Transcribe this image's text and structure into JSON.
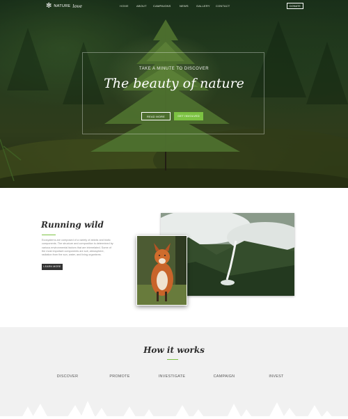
{
  "nav": {
    "logo_text": "NATURE",
    "logo_script": "love",
    "items": [
      {
        "label": "HOME",
        "active": true
      },
      {
        "label": "ABOUT",
        "active": false
      },
      {
        "label": "CAMPAIGNS",
        "active": false
      },
      {
        "label": "NEWS",
        "active": false
      },
      {
        "label": "GALLERY",
        "active": false
      },
      {
        "label": "CONTACT",
        "active": false
      }
    ],
    "donate_label": "DONATE"
  },
  "hero": {
    "subtitle": "TAKE A MINUTE TO DISCOVER",
    "title": "The beauty of nature",
    "read_more_label": "READ MORE",
    "involved_label": "GET INVOLVED"
  },
  "running_wild": {
    "title": "Running wild",
    "body": "Ecosystems are composed of a variety of abiotic and biotic components. The structure and composition is determined by various environmental factors that are interrelated. Some of the most important components are soil, atmosphere, radiation from the sun, water, and living organisms.",
    "button_label": "LEARN MORE"
  },
  "how_it_works": {
    "title": "How it works",
    "steps": [
      "DISCOVER",
      "PROMOTE",
      "INVESTIGATE",
      "CAMPAIGN",
      "INVEST"
    ]
  },
  "colors": {
    "accent": "#7cc242",
    "dark": "#333333",
    "section_bg": "#f1f1f1"
  }
}
